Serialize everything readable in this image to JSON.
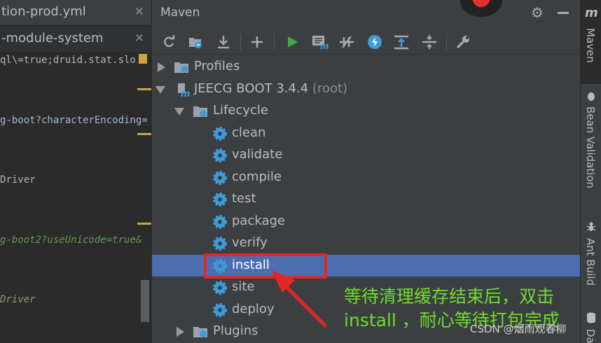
{
  "editor": {
    "tabs": [
      {
        "label": "tion-prod.yml",
        "close": "✕"
      },
      {
        "label": "-module-system",
        "close": "✕"
      }
    ],
    "lines": [
      "ql\\=true;druid.stat.slo",
      "g-boot?characterEncoding=",
      "Driver",
      "g-boot2?useUnicode=true&",
      "Driver"
    ]
  },
  "maven": {
    "title": "Maven",
    "toolbar": [
      "reload-icon",
      "generate-sources-icon",
      "download-icon",
      "add-icon",
      "run-icon",
      "execute-goal-icon",
      "toggle-offline-icon",
      "skip-tests-icon",
      "show-dependencies-icon",
      "collapse-all-icon",
      "settings-wrench-icon"
    ],
    "tree": {
      "profiles": "Profiles",
      "project": "JEECG BOOT 3.4.4",
      "project_suffix": "(root)",
      "lifecycle": "Lifecycle",
      "phases": [
        "clean",
        "validate",
        "compile",
        "test",
        "package",
        "verify",
        "install",
        "site",
        "deploy"
      ],
      "selected_phase": "install",
      "plugins": "Plugins"
    },
    "annotation": {
      "line1": "等待清理缓存结束后，双击",
      "line2": "install ，耐心等待打包完成",
      "color": "#6fdc2e"
    },
    "watermark": "CSDN @烟雨观春柳"
  },
  "side_tools": {
    "maven_icon": "m",
    "maven": "Maven",
    "bean_validation": "Bean Validation",
    "ant_build": "Ant Build",
    "database_partial": "Da"
  },
  "colors": {
    "selection": "#4b6eaf",
    "highlight": "#e32626",
    "run_green": "#3ea94e",
    "accent_blue": "#3d9bd9"
  }
}
